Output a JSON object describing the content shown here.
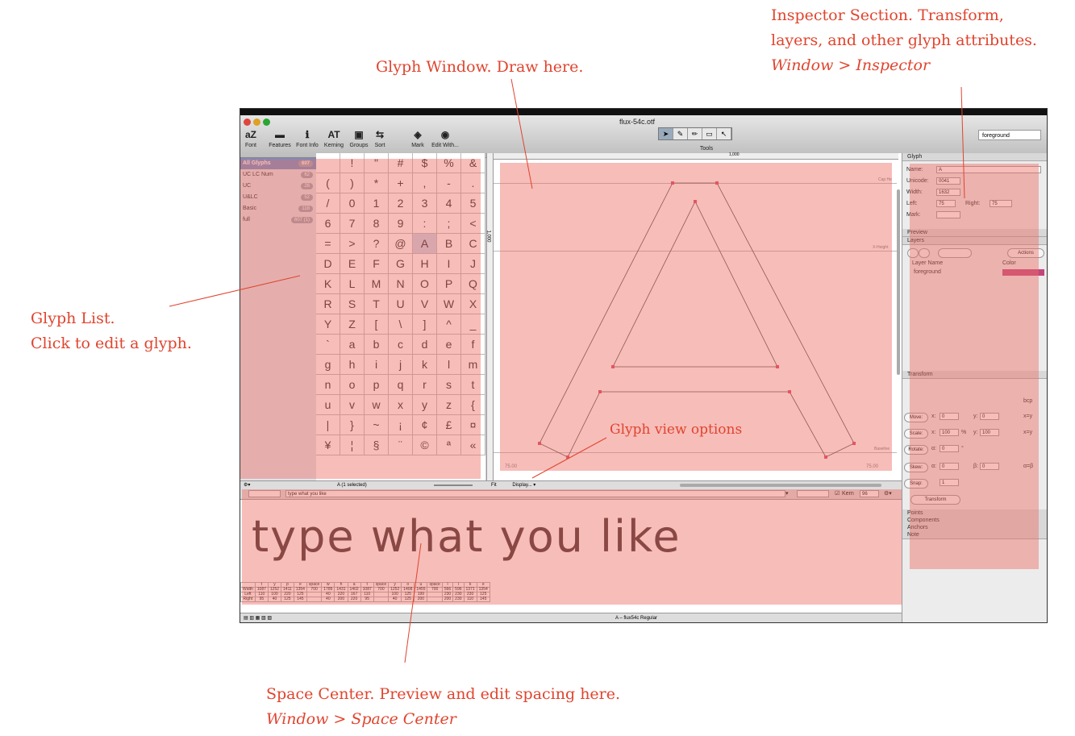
{
  "annotations": {
    "inspector": [
      "Inspector Section. Transform,",
      "layers, and other glyph attributes."
    ],
    "inspector_menu": "Window > Inspector",
    "glyph_window": "Glyph Window. Draw here.",
    "glyph_list": [
      "Glyph List.",
      "Click to edit a glyph."
    ],
    "glyph_view_options": "Glyph view options",
    "space_center": "Space Center. Preview and edit spacing here.",
    "space_center_menu": "Window > Space Center"
  },
  "window": {
    "title": "flux-54c.otf",
    "toolbar": [
      "Font",
      "Features",
      "Font Info",
      "Kerning",
      "Groups",
      "Sort",
      "Mark",
      "Edit With..."
    ],
    "tools_label": "Tools",
    "layer_select": "foreground"
  },
  "sidebar": [
    {
      "label": "All Glyphs",
      "count": "607"
    },
    {
      "label": "UC LC Num",
      "count": "62"
    },
    {
      "label": "UC",
      "count": "26"
    },
    {
      "label": "U&LC",
      "count": "52"
    },
    {
      "label": "Basic",
      "count": "118"
    },
    {
      "label": "full",
      "count": "607 (1)"
    }
  ],
  "glyph_cells": [
    "",
    "!",
    "\"",
    "#",
    "$",
    "%",
    "&",
    "(",
    ")",
    "*",
    "+",
    ",",
    "-",
    ".",
    "/",
    "0",
    "1",
    "2",
    "3",
    "4",
    "5",
    "6",
    "7",
    "8",
    "9",
    ":",
    ";",
    "<",
    "=",
    ">",
    "?",
    "@",
    "A",
    "B",
    "C",
    "D",
    "E",
    "F",
    "G",
    "H",
    "I",
    "J",
    "K",
    "L",
    "M",
    "N",
    "O",
    "P",
    "Q",
    "R",
    "S",
    "T",
    "U",
    "V",
    "W",
    "X",
    "Y",
    "Z",
    "[",
    "\\",
    "]",
    "^",
    "_",
    "`",
    "a",
    "b",
    "c",
    "d",
    "e",
    "f",
    "g",
    "h",
    "i",
    "j",
    "k",
    "l",
    "m",
    "n",
    "o",
    "p",
    "q",
    "r",
    "s",
    "t",
    "u",
    "v",
    "w",
    "x",
    "y",
    "z",
    "{",
    "|",
    "}",
    "~",
    "¡",
    "¢",
    "£",
    "¤",
    "¥",
    "¦",
    "§",
    "¨",
    "©",
    "ª",
    "«"
  ],
  "grid_status": "A (1 selected)",
  "glyph_view": {
    "ruler_value": "1,000",
    "vmetric": "1,000",
    "cap_height": "Cap He",
    "x_height": "X-Height",
    "baseline": "Baseline",
    "left_margin": "75.00",
    "right_margin": "75.00",
    "fit": "Fit",
    "display": "Display..."
  },
  "inspector": {
    "glyph_header": "Glyph",
    "name_label": "Name:",
    "name": "A",
    "unicode_label": "Unicode:",
    "unicode": "0041",
    "width_label": "Width:",
    "width": "1632",
    "left_label": "Left:",
    "left": "75",
    "right_label": "Right:",
    "right": "75",
    "mark_label": "Mark:",
    "preview_header": "Preview",
    "layers_header": "Layers",
    "actions": "Actions",
    "layer_col_name": "Layer Name",
    "layer_col_color": "Color",
    "layer_name": "foreground",
    "layer_color": "#c2457a",
    "transform_header": "Transform",
    "bcp": "bcp",
    "move_btn": "Move:",
    "move_x_label": "x:",
    "move_x": "0",
    "move_y_label": "y:",
    "move_y": "0",
    "xy": "x=y",
    "scale_btn": "Scale:",
    "scale_x_label": "x:",
    "scale_x": "100",
    "scale_y_label": "y:",
    "scale_y": "100",
    "pct": "%",
    "xy2": "x=y",
    "rotate_btn": "Rotate:",
    "rotate_label": "α:",
    "rotate": "0",
    "deg": "°",
    "skew_btn": "Skew:",
    "skew_a_label": "α:",
    "skew_a": "0",
    "skew_b_label": "β:",
    "skew_b": "0",
    "ab": "α=β",
    "snap_btn": "Snap:",
    "snap": "1",
    "transform_btn": "Transform",
    "more_sections": [
      "Points",
      "Components",
      "Anchors",
      "Note"
    ]
  },
  "space_center": {
    "input": "type what you like",
    "kern_label": "Kern",
    "size": "96",
    "preview": "type what you like",
    "table": {
      "glyphs": [
        "t",
        "y",
        "p",
        "e",
        "space",
        "w",
        "h",
        "a",
        "t",
        "space",
        "y",
        "o",
        "u",
        "space",
        "l",
        "i",
        "k",
        "e"
      ],
      "width_label": "Width",
      "width": [
        "1087",
        "1252",
        "1411",
        "1354",
        "700",
        "1785",
        "1431",
        "1402",
        "1087",
        "700",
        "1252",
        "1408",
        "1455",
        "700",
        "566",
        "596",
        "1371",
        "1354"
      ],
      "left_label": "Left",
      "left": [
        "110",
        "100",
        "220",
        "125",
        "",
        "40",
        "220",
        "167",
        "110",
        "",
        "100",
        "125",
        "199",
        "",
        "230",
        "230",
        "230",
        "125"
      ],
      "right_label": "Right",
      "right": [
        "95",
        "40",
        "125",
        "145",
        "",
        "40",
        "200",
        "220",
        "95",
        "",
        "40",
        "125",
        "200",
        "",
        "200",
        "230",
        "110",
        "145"
      ]
    },
    "status": "A – flux54c Regular"
  }
}
